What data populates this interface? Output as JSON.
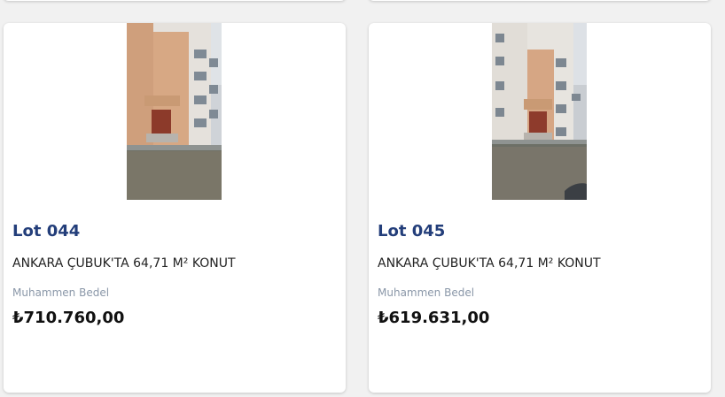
{
  "cards": [
    {
      "lot": "Lot 044",
      "title": "ANKARA ÇUBUK'TA 64,71 M² KONUT",
      "price_label": "Muhammen Bedel",
      "price": "₺710.760,00"
    },
    {
      "lot": "Lot 045",
      "title": "ANKARA ÇUBUK'TA 64,71 M² KONUT",
      "price_label": "Muhammen Bedel",
      "price": "₺619.631,00"
    }
  ],
  "colors": {
    "lot_title": "#233e7a",
    "background": "#f1f1f1",
    "card": "#ffffff",
    "muted": "#8a97a8"
  }
}
